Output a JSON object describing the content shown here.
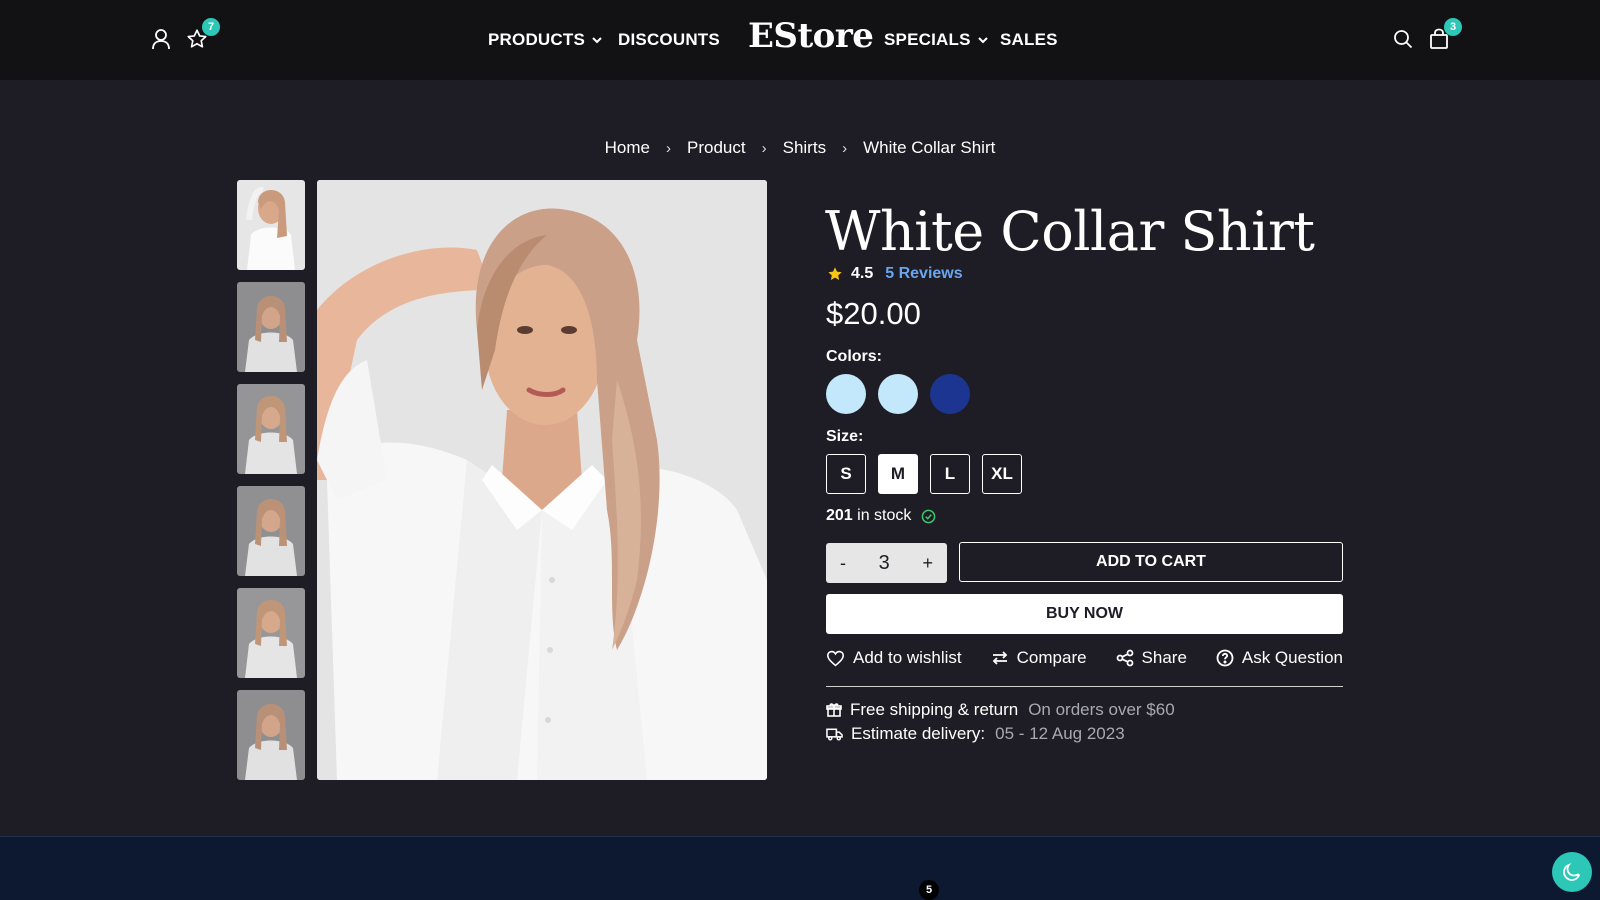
{
  "header": {
    "logo": "EStore",
    "nav": [
      {
        "label": "PRODUCTS",
        "has_dropdown": true
      },
      {
        "label": "DISCOUNTS",
        "has_dropdown": false
      },
      {
        "label": "SPECIALS",
        "has_dropdown": true
      },
      {
        "label": "SALES",
        "has_dropdown": false
      }
    ],
    "wishlist_count": "7",
    "cart_count": "3",
    "icons": {
      "account": "user-icon",
      "wishlist": "star-icon",
      "search": "search-icon",
      "cart": "shopping-bag-icon"
    }
  },
  "breadcrumb": [
    "Home",
    "Product",
    "Shirts",
    "White Collar Shirt"
  ],
  "gallery": {
    "thumbnail_count": 6,
    "active_thumbnail": 1
  },
  "product": {
    "title": "White Collar Shirt",
    "rating": "4.5",
    "reviews": "5 Reviews",
    "price": "$20.00",
    "colors_label": "Colors:",
    "colors": [
      "#c3e8fb",
      "#c3e8fb",
      "#1b3591"
    ],
    "size_label": "Size:",
    "sizes": [
      "S",
      "M",
      "L",
      "XL"
    ],
    "selected_size": "M",
    "stock_count": "201",
    "stock_text": "in stock",
    "quantity": "3",
    "minus": "-",
    "plus": "+",
    "add_to_cart": "ADD TO CART",
    "buy_now": "BUY NOW",
    "actions": [
      "Add to wishlist",
      "Compare",
      "Share",
      "Ask Question"
    ],
    "shipping_label": "Free shipping & return",
    "shipping_note": "On orders over $60",
    "delivery_label": "Estimate delivery:",
    "delivery_dates": "05 - 12 Aug 2023"
  },
  "footer": {
    "badge": "5"
  },
  "colors": {
    "accent": "#2cc7b6",
    "star": "#f5c518",
    "link": "#6aa5f0",
    "stock_ok": "#3ec46d"
  }
}
